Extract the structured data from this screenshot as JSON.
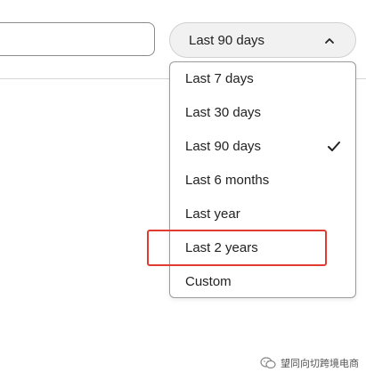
{
  "range_select": {
    "selected_label": "Last 90 days",
    "icon": "chevron-up-icon",
    "expanded": true
  },
  "menu": {
    "items": [
      {
        "label": "Last 7 days",
        "selected": false
      },
      {
        "label": "Last 30 days",
        "selected": false
      },
      {
        "label": "Last 90 days",
        "selected": true
      },
      {
        "label": "Last 6 months",
        "selected": false
      },
      {
        "label": "Last year",
        "selected": false
      },
      {
        "label": "Last 2 years",
        "selected": false,
        "annotated": true
      },
      {
        "label": "Custom",
        "selected": false
      }
    ],
    "check_icon": "checkmark-icon"
  },
  "annotation": {
    "color": "#e03c32",
    "target": "Last 2 years"
  },
  "watermark": {
    "text": "望同向切跨境电商",
    "icon": "wechat-icon"
  },
  "colors": {
    "select_bg": "#f1f1f1",
    "border": "#9b9b9b",
    "text": "#222222"
  }
}
